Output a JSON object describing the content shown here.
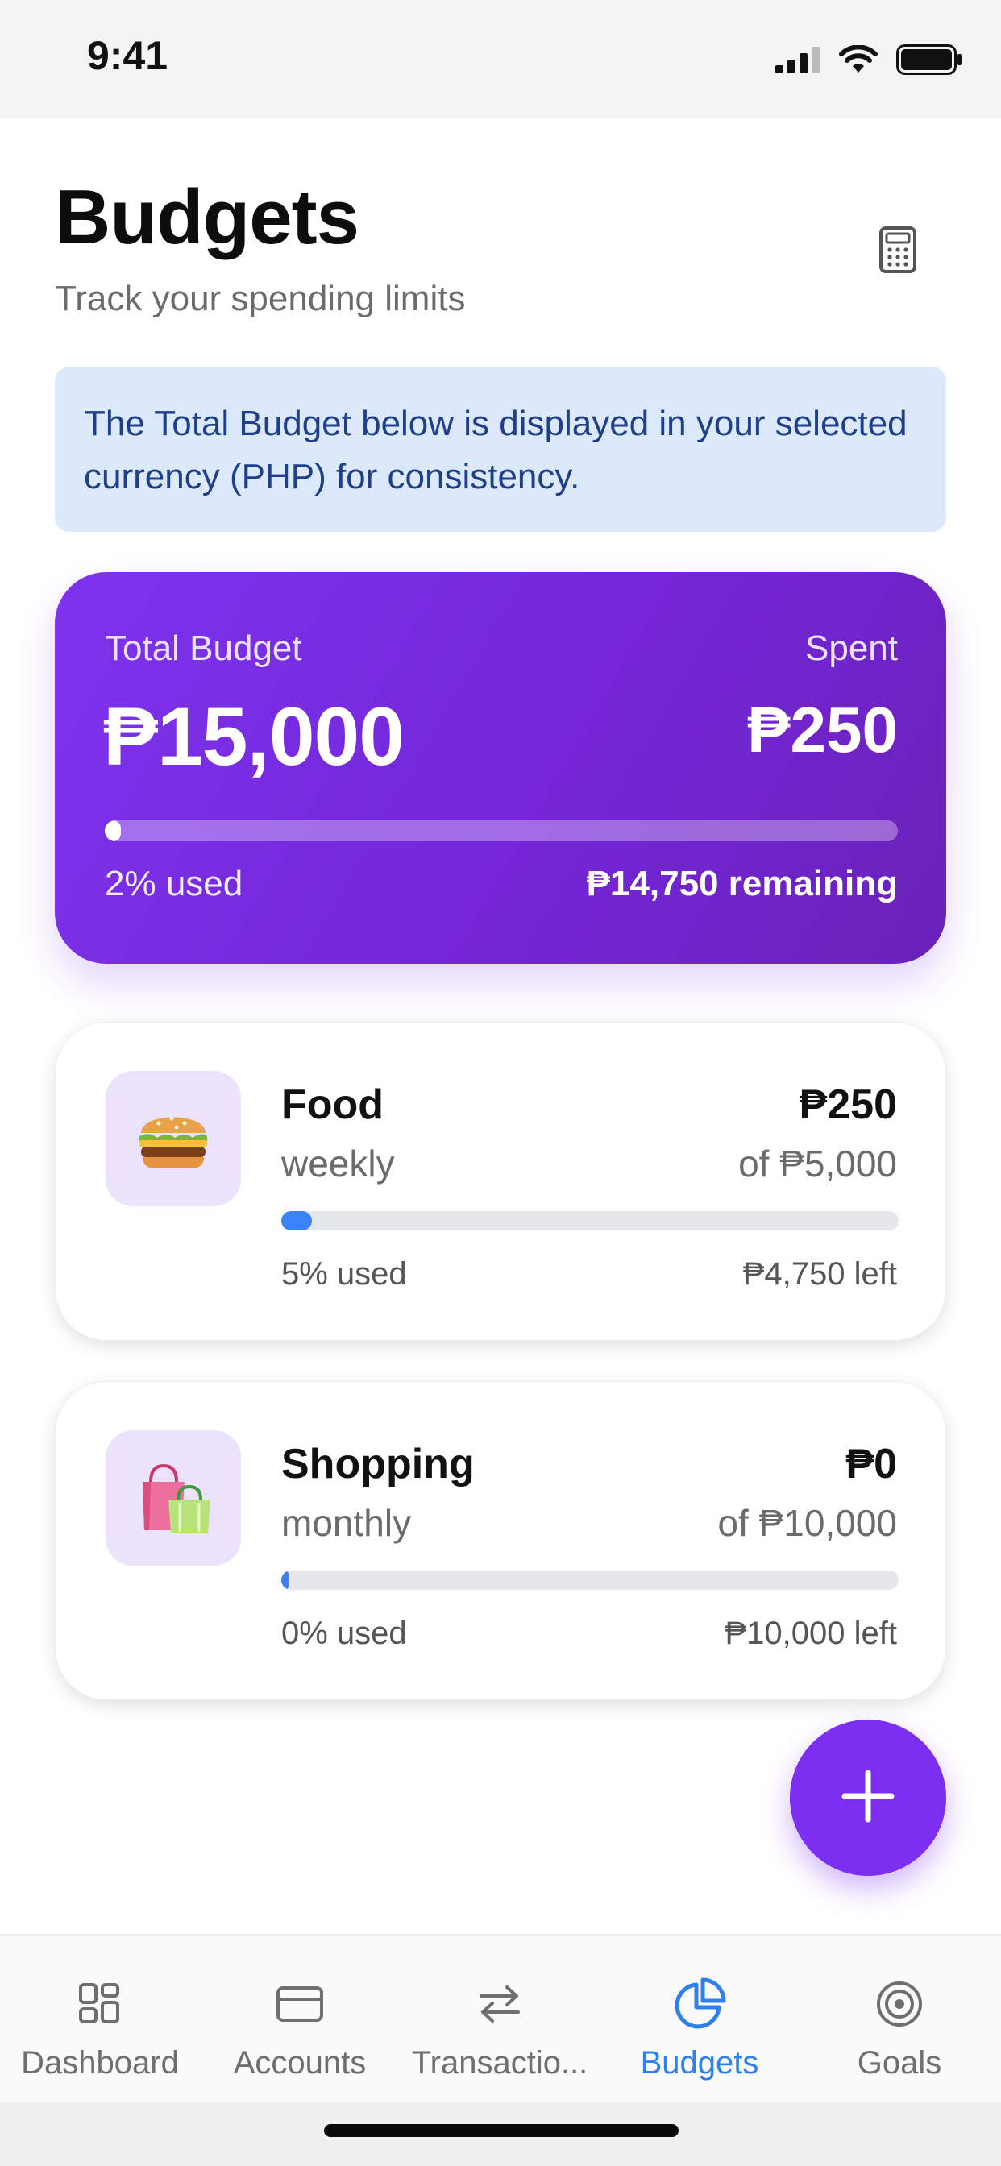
{
  "status_bar": {
    "time": "9:41"
  },
  "header": {
    "title": "Budgets",
    "subtitle": "Track your spending limits",
    "action_icon": "calculator-icon"
  },
  "notice": {
    "text": "The Total Budget below is displayed in your selected currency (PHP) for consistency."
  },
  "total_budget": {
    "label": "Total Budget",
    "amount": "₱15,000",
    "spent_label": "Spent",
    "spent": "₱250",
    "used_text": "2% used",
    "used_fraction": 0.02,
    "remaining_text": "₱14,750 remaining"
  },
  "budgets": [
    {
      "icon": "hamburger-icon",
      "name": "Food",
      "period": "weekly",
      "spent": "₱250",
      "limit": "of ₱5,000",
      "used_text": "5% used",
      "used_fraction": 0.05,
      "left_text": "₱4,750 left"
    },
    {
      "icon": "shopping-bags-icon",
      "name": "Shopping",
      "period": "monthly",
      "spent": "₱0",
      "limit": "of ₱10,000",
      "used_text": "0% used",
      "used_fraction": 0.0,
      "left_text": "₱10,000 left"
    }
  ],
  "fab": {
    "icon": "plus-icon"
  },
  "tabs": [
    {
      "label": "Dashboard",
      "icon": "dashboard-grid-icon",
      "active": false
    },
    {
      "label": "Accounts",
      "icon": "card-icon",
      "active": false
    },
    {
      "label": "Transactio...",
      "icon": "transfer-arrows-icon",
      "active": false
    },
    {
      "label": "Budgets",
      "icon": "pie-chart-icon",
      "active": true
    },
    {
      "label": "Goals",
      "icon": "target-icon",
      "active": false
    }
  ],
  "colors": {
    "accent_purple": "#7C2FF0",
    "active_tab_blue": "#2F80ED",
    "progress_blue": "#3B82F6",
    "notice_bg": "#DBE9FB"
  }
}
